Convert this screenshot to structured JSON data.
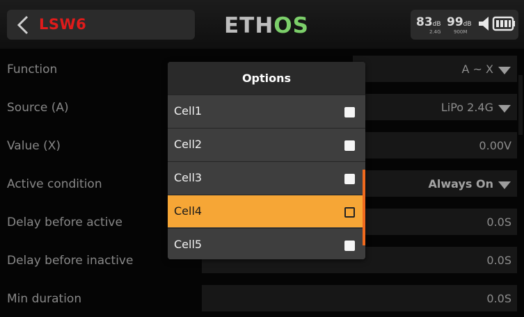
{
  "header": {
    "title": "LSW6",
    "logo_part1": "ETH",
    "logo_part2": "OS",
    "rssi1": "83",
    "rssi1_unit": "dB",
    "rssi1_band": "2.4G",
    "rssi2": "99",
    "rssi2_unit": "dB",
    "rssi2_band": "900M"
  },
  "rows": [
    {
      "label": "Function",
      "value": "A ~ X"
    },
    {
      "label": "Source (A)",
      "value": "LiPo 2.4G"
    },
    {
      "label": "Value (X)",
      "value": "0.00V"
    },
    {
      "label": "Active condition",
      "value": "Always On"
    },
    {
      "label": "Delay before active",
      "value": "0.0S"
    },
    {
      "label": "Delay before inactive",
      "value": "0.0S"
    },
    {
      "label": "Min duration",
      "value": "0.0S"
    }
  ],
  "popup": {
    "title": "Options",
    "options": [
      {
        "label": "Cell1",
        "checked": false
      },
      {
        "label": "Cell2",
        "checked": false
      },
      {
        "label": "Cell3",
        "checked": false
      },
      {
        "label": "Cell4",
        "checked": false,
        "highlighted": true
      },
      {
        "label": "Cell5",
        "checked": false
      }
    ]
  },
  "colors": {
    "title_red": "#e01b1b",
    "logo_green": "#7ccf6a",
    "highlight_orange": "#f6a636",
    "scrollbar_orange": "#f06a1e"
  },
  "icons": [
    "back-arrow-icon",
    "speaker-icon",
    "battery-icon",
    "dropdown-triangle-icon",
    "checkbox-icon"
  ]
}
